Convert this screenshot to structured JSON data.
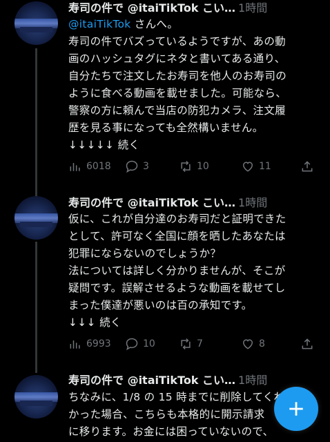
{
  "tweets": [
    {
      "name": "寿司の件で @itaiTikTok こい…",
      "time": "1時間",
      "mention": "@itaiTikTok",
      "mention_suffix": " さんへ。",
      "text": "寿司の件でバズっているようですが、あの動\n画のハッシュタグにネタと書いてある通り、\n自分たちで注文したお寿司を他人のお寿司の\nように食べる動画を載せました。可能なら、\n警察の方に頼んで当店の防犯カメラ、注文履\n歴を見る事になっても全然構いません。\n↓↓↓↓↓ 続く",
      "views": "6018",
      "replies": "3",
      "retweets": "10",
      "likes": "11"
    },
    {
      "name": "寿司の件で @itaiTikTok こい…",
      "time": "1時間",
      "text": "仮に、これが自分達のお寿司だと証明できた\nとして、許可なく全国に顔を晒したあなたは\n犯罪にならないのでしょうか？\n法については詳しく分かりませんが、そこが\n疑問です。誤解させるような動画を載せてし\nまった僕達が悪いのは百の承知です。\n↓↓↓ 続く",
      "views": "6993",
      "replies": "10",
      "retweets": "7",
      "likes": "8"
    },
    {
      "name": "寿司の件で @itaiTikTok こい…",
      "time": "1時間",
      "text": "ちなみに、1/8 の 15 時までに削除してくれな\nかった場合、こちらも本格的に開示請求\nに移ります。お金には困っていないので、"
    }
  ],
  "colors": {
    "background": "#000000",
    "text": "#e7e9ea",
    "muted": "#71767b",
    "accent": "#1d9bf0"
  },
  "icons": {
    "views": "bar-chart-icon",
    "reply": "speech-bubble-icon",
    "retweet": "retweet-icon",
    "like": "heart-icon",
    "share": "share-icon",
    "compose": "plus-icon"
  }
}
